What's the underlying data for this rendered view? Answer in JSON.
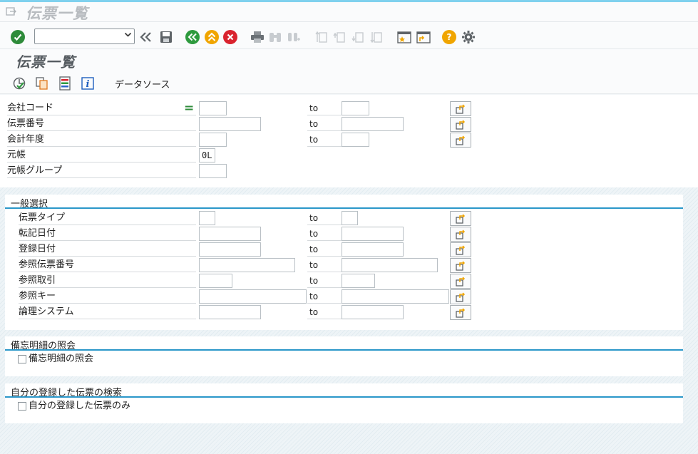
{
  "window": {
    "title": "伝票一覧"
  },
  "toolbar": {
    "command_field": {
      "value": "",
      "placeholder": ""
    },
    "icons": [
      "enter-check-icon",
      "command-dropdown-icon",
      "back-double-chevron-icon",
      "save-icon",
      "back-icon",
      "exit-icon",
      "cancel-icon",
      "print-icon",
      "find-icon",
      "find-next-icon",
      "first-page-icon",
      "previous-page-icon",
      "next-page-icon",
      "last-page-icon",
      "create-session-icon",
      "shortcut-icon",
      "help-icon",
      "settings-gear-icon"
    ]
  },
  "app": {
    "title": "伝票一覧",
    "toolbar": {
      "data_source_label": "データソース"
    }
  },
  "selection": {
    "to_label": "to",
    "fields": [
      {
        "label": "会社コード",
        "value": "",
        "to_value": ""
      },
      {
        "label": "伝票番号",
        "value": "",
        "to_value": ""
      },
      {
        "label": "会計年度",
        "value": "",
        "to_value": ""
      },
      {
        "label": "元帳",
        "value": "0L"
      },
      {
        "label": "元帳グループ",
        "value": ""
      }
    ]
  },
  "general": {
    "title": "一般選択",
    "fields": [
      {
        "label": "伝票タイプ",
        "value": "",
        "to_value": ""
      },
      {
        "label": "転記日付",
        "value": "",
        "to_value": ""
      },
      {
        "label": "登録日付",
        "value": "",
        "to_value": ""
      },
      {
        "label": "参照伝票番号",
        "value": "",
        "to_value": ""
      },
      {
        "label": "参照取引",
        "value": "",
        "to_value": ""
      },
      {
        "label": "参照キー",
        "value": "",
        "to_value": ""
      },
      {
        "label": "論理システム",
        "value": "",
        "to_value": ""
      }
    ]
  },
  "memo": {
    "title": "備忘明細の照会",
    "checkbox_label": "備忘明細の照会",
    "checked": false
  },
  "own": {
    "title": "自分の登録した伝票の検索",
    "checkbox_label": "自分の登録した伝票のみ",
    "checked": false
  },
  "colors": {
    "accent_line": "#2a97c9",
    "ok_green": "#2e8b3a",
    "nav_green": "#2e9a3e",
    "exit_yellow": "#f0a500",
    "cancel_red": "#d9232e"
  }
}
